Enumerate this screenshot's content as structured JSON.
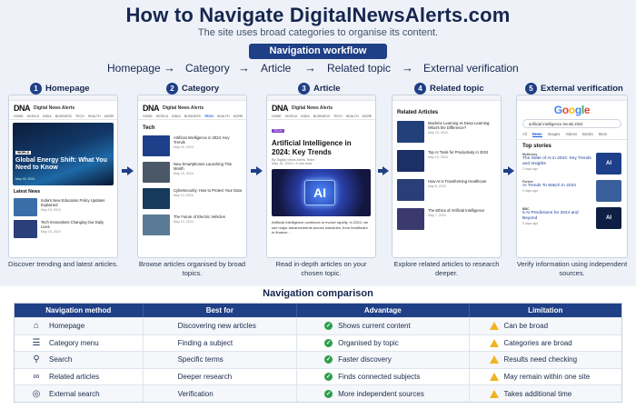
{
  "header": {
    "title": "How to Navigate DigitalNewsAlerts.com",
    "subtitle": "The site uses broad categories to organise its content.",
    "workflow_label": "Navigation workflow",
    "flow": [
      "Homepage",
      "Category",
      "Article",
      "Related topic",
      "External verification"
    ],
    "flow_arrow": "→"
  },
  "steps": [
    {
      "num": "1",
      "label": "Homepage",
      "caption": "Discover trending and latest articles."
    },
    {
      "num": "2",
      "label": "Category",
      "caption": "Browse articles organised by broad topics."
    },
    {
      "num": "3",
      "label": "Article",
      "caption": "Read in-depth articles on your chosen topic."
    },
    {
      "num": "4",
      "label": "Related topic",
      "caption": "Explore related articles to research deeper."
    },
    {
      "num": "5",
      "label": "External verification",
      "caption": "Verify information using independent sources."
    }
  ],
  "site": {
    "logo": "DNA",
    "name": "Digital News Alerts",
    "nav": [
      "HOME",
      "WORLD",
      "INDIA",
      "BUSINESS",
      "TECH",
      "HEALTH",
      "MORE"
    ]
  },
  "homepage": {
    "badge": "WORLD",
    "hero_title": "Global Energy Shift: What You Need to Know",
    "hero_date": "May 16, 2024",
    "section": "Latest News",
    "items": [
      {
        "title": "India's New Education Policy Updates Explained",
        "date": "May 16, 2024",
        "color": "#3a6ea8"
      },
      {
        "title": "Tech Innovations Changing Our Daily Lives",
        "date": "May 16, 2024",
        "color": "#2b3f7a"
      }
    ]
  },
  "category": {
    "section": "Tech",
    "items": [
      {
        "title": "Artificial Intelligence in 2024: Key Trends",
        "date": "May 16, 2024",
        "color": "#1e3f8a"
      },
      {
        "title": "New Smartphones Launching This Month",
        "date": "May 15, 2024",
        "color": "#4a5868"
      },
      {
        "title": "Cybersecurity: How to Protect Your Data",
        "date": "May 14, 2024",
        "color": "#153a5a"
      },
      {
        "title": "The Future of Electric Vehicles",
        "date": "May 13, 2024",
        "color": "#5a7a95"
      }
    ]
  },
  "article": {
    "tag": "TECH",
    "title": "Artificial Intelligence in 2024: Key Trends",
    "meta": "By Digital News Alerts Team",
    "meta2": "May 16, 2024  •  5 min read",
    "image_text": "AI",
    "body": "Artificial Intelligence continues to evolve rapidly. In 2024, we see major advancements across industries, from healthcare to finance..."
  },
  "related": {
    "section": "Related Articles",
    "items": [
      {
        "title": "Machine Learning vs Deep Learning: What's the Difference?",
        "date": "May 15, 2024",
        "color": "#22407a"
      },
      {
        "title": "Top AI Tools for Productivity in 2024",
        "date": "May 10, 2024",
        "color": "#1c2f66"
      },
      {
        "title": "How AI is Transforming Healthcare",
        "date": "May 8, 2024",
        "color": "#2a3e78"
      },
      {
        "title": "The Ethics of Artificial Intelligence",
        "date": "May 7, 2024",
        "color": "#3b3a6e"
      }
    ]
  },
  "google": {
    "logo": "Google",
    "query": "artificial intelligence trends 2024",
    "tabs": [
      "All",
      "News",
      "Images",
      "Videos",
      "Books",
      "More"
    ],
    "active_tab": "News",
    "section": "Top stories",
    "items": [
      {
        "source": "McKinsey",
        "title": "The State of AI in 2024: Key Trends and Insights",
        "date": "2 days ago",
        "thumb": "AI",
        "color": "#1e3f8a"
      },
      {
        "source": "Forbes",
        "title": "AI Trends To Watch In 2024",
        "date": "3 days ago",
        "thumb": "",
        "color": "#3a5f9a"
      },
      {
        "source": "BBC",
        "title": "5 AI Predictions for 2024 and Beyond",
        "date": "5 days ago",
        "thumb": "AI",
        "color": "#0f1f44"
      }
    ]
  },
  "comparison": {
    "title": "Navigation comparison",
    "headers": [
      "Navigation method",
      "Best for",
      "Advantage",
      "Limitation"
    ],
    "rows": [
      {
        "icon": "home-icon",
        "glyph": "⌂",
        "method": "Homepage",
        "best": "Discovering new articles",
        "adv": "Shows current content",
        "lim": "Can be broad"
      },
      {
        "icon": "list-icon",
        "glyph": "☰",
        "method": "Category menu",
        "best": "Finding a subject",
        "adv": "Organised by topic",
        "lim": "Categories are broad"
      },
      {
        "icon": "search-icon",
        "glyph": "⚲",
        "method": "Search",
        "best": "Specific terms",
        "adv": "Faster discovery",
        "lim": "Results need checking"
      },
      {
        "icon": "link-icon",
        "glyph": "∞",
        "method": "Related articles",
        "best": "Deeper research",
        "adv": "Finds connected subjects",
        "lim": "May remain within one site"
      },
      {
        "icon": "globe-icon",
        "glyph": "◎",
        "method": "External search",
        "best": "Verification",
        "adv": "More independent sources",
        "lim": "Takes additional time"
      }
    ],
    "colors": {
      "header": "#1f3f86",
      "ok": "#2e9e4a",
      "warn": "#f0b323"
    }
  }
}
